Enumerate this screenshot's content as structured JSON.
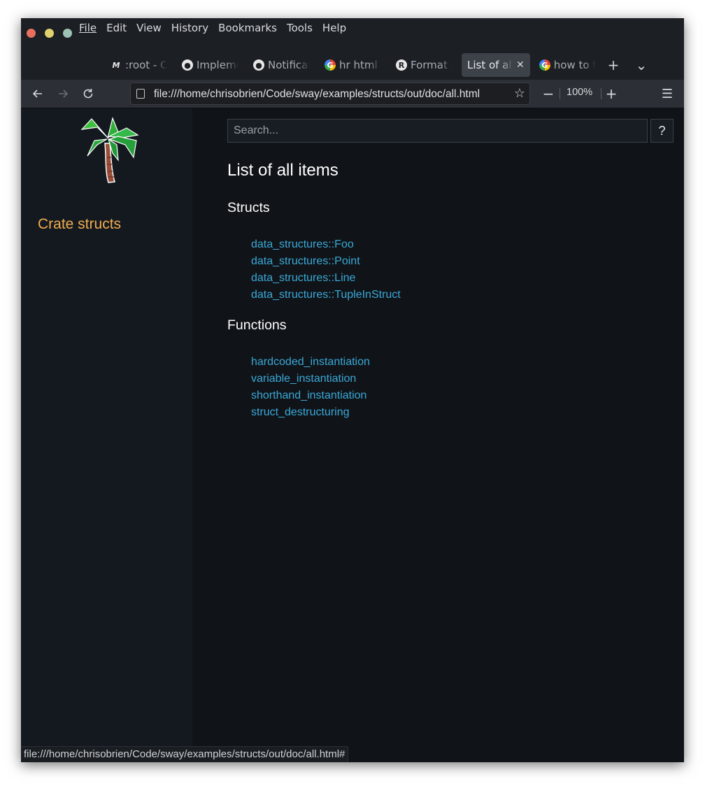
{
  "menu": [
    {
      "label": "File"
    },
    {
      "label": "Edit"
    },
    {
      "label": "View"
    },
    {
      "label": "History"
    },
    {
      "label": "Bookmarks"
    },
    {
      "label": "Tools"
    },
    {
      "label": "Help"
    }
  ],
  "tabs": [
    {
      "label": ":root - C",
      "icon": "m-icon",
      "active": false
    },
    {
      "label": "Impleme",
      "icon": "github-icon",
      "active": false
    },
    {
      "label": "Notificat",
      "icon": "github-icon",
      "active": false
    },
    {
      "label": "hr html",
      "icon": "google-icon",
      "active": false
    },
    {
      "label": "Format i",
      "icon": "rust-icon",
      "active": false
    },
    {
      "label": "List of all",
      "icon": "",
      "active": true
    },
    {
      "label": "how to t",
      "icon": "google-icon",
      "active": false
    }
  ],
  "toolbar": {
    "url": "file:///home/chrisobrien/Code/sway/examples/structs/out/doc/all.html",
    "zoom": "100%"
  },
  "sidebar": {
    "crate_title": "Crate structs"
  },
  "search": {
    "placeholder": "Search...",
    "help_label": "?"
  },
  "page": {
    "title": "List of all items",
    "sections": [
      {
        "title": "Structs",
        "items": [
          "data_structures::Foo",
          "data_structures::Point",
          "data_structures::Line",
          "data_structures::TupleInStruct"
        ]
      },
      {
        "title": "Functions",
        "items": [
          "hardcoded_instantiation",
          "variable_instantiation",
          "shorthand_instantiation",
          "struct_destructuring"
        ]
      }
    ]
  },
  "statusbar": {
    "text": "file:///home/chrisobrien/Code/sway/examples/structs/out/doc/all.html#"
  },
  "colors": {
    "link": "#3aa8d8",
    "crate_title": "#f0ad4e",
    "background": "#101418",
    "sidebar": "#141920"
  }
}
